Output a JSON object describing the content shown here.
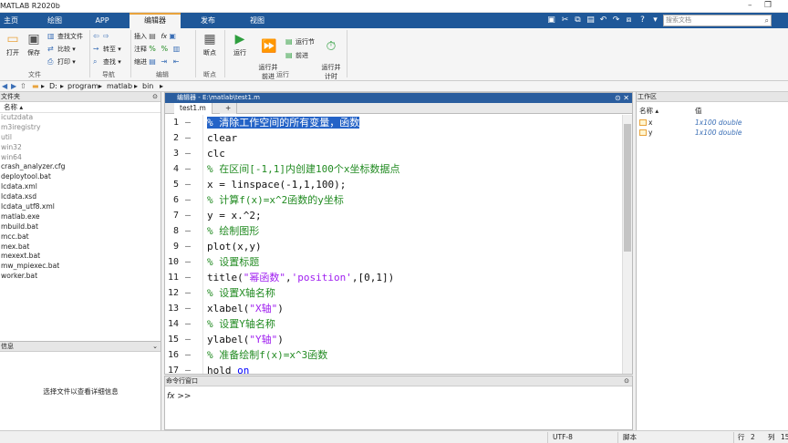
{
  "window": {
    "title": "MATLAB R2020b"
  },
  "tabs": [
    "主页",
    "绘图",
    "APP",
    "编辑器",
    "发布",
    "视图"
  ],
  "search": {
    "placeholder": "搜索文档"
  },
  "ribbon": {
    "file": {
      "open": "打开",
      "save": "保存",
      "find_files": "查找文件",
      "compare": "比较",
      "print": "打印",
      "group": "文件"
    },
    "nav": {
      "goto": "转至",
      "find": "查找",
      "group": "导航"
    },
    "edit": {
      "insert": "插入",
      "comment": "注释",
      "indent": "缩进",
      "fx": "fx",
      "group": "编辑"
    },
    "breakpoints": {
      "label": "断点",
      "group": "断点"
    },
    "run": {
      "run": "运行",
      "run_advance": "运行并\n前进",
      "run_section": "运行节",
      "advance": "前进",
      "run_time": "运行并\n计时",
      "group": "运行"
    }
  },
  "address": {
    "path": [
      "D:",
      "program",
      "matlab",
      "bin"
    ]
  },
  "current_folder": {
    "title": "文件夹",
    "col_name": "名称",
    "files": [
      {
        "name": "icutzdata",
        "dim": true
      },
      {
        "name": "m3iregistry",
        "dim": true
      },
      {
        "name": "util",
        "dim": true
      },
      {
        "name": "win32",
        "dim": true
      },
      {
        "name": "win64",
        "dim": true
      },
      {
        "name": "crash_analyzer.cfg",
        "dim": false
      },
      {
        "name": "deploytool.bat",
        "dim": false
      },
      {
        "name": "lcdata.xml",
        "dim": false
      },
      {
        "name": "lcdata.xsd",
        "dim": false
      },
      {
        "name": "lcdata_utf8.xml",
        "dim": false
      },
      {
        "name": "matlab.exe",
        "dim": false
      },
      {
        "name": "mbuild.bat",
        "dim": false
      },
      {
        "name": "mcc.bat",
        "dim": false
      },
      {
        "name": "mex.bat",
        "dim": false
      },
      {
        "name": "mexext.bat",
        "dim": false
      },
      {
        "name": "mw_mpiexec.bat",
        "dim": false
      },
      {
        "name": "worker.bat",
        "dim": false
      }
    ]
  },
  "details": {
    "title": "信息",
    "message": "选择文件以查看详细信息"
  },
  "editor": {
    "title": "编辑器 - E:\\matlab\\test1.m",
    "tab": "test1.m",
    "add_tab": "+",
    "lines": [
      {
        "n": "1",
        "parts": [
          {
            "t": "% 清除工作空间的所有变量，函数",
            "c": "cm sel"
          }
        ]
      },
      {
        "n": "2",
        "parts": [
          {
            "t": "clear",
            "c": ""
          }
        ]
      },
      {
        "n": "3",
        "parts": [
          {
            "t": "clc",
            "c": ""
          }
        ]
      },
      {
        "n": "4",
        "parts": [
          {
            "t": "% 在区间[-1,1]内创建100个x坐标数据点",
            "c": "cm"
          }
        ]
      },
      {
        "n": "5",
        "parts": [
          {
            "t": "x = linspace(-1,1,100);",
            "c": ""
          }
        ]
      },
      {
        "n": "6",
        "parts": [
          {
            "t": "% 计算f(x)=x^2函数的y坐标",
            "c": "cm"
          }
        ]
      },
      {
        "n": "7",
        "parts": [
          {
            "t": "y = x.^2;",
            "c": ""
          }
        ]
      },
      {
        "n": "8",
        "parts": [
          {
            "t": "% 绘制图形",
            "c": "cm"
          }
        ]
      },
      {
        "n": "9",
        "parts": [
          {
            "t": "plot(x,y)",
            "c": ""
          }
        ]
      },
      {
        "n": "10",
        "parts": [
          {
            "t": "% 设置标题",
            "c": "cm"
          }
        ]
      },
      {
        "n": "11",
        "parts": [
          {
            "t": "title(",
            "c": ""
          },
          {
            "t": "\"幂函数\"",
            "c": "str"
          },
          {
            "t": ",",
            "c": ""
          },
          {
            "t": "'position'",
            "c": "str"
          },
          {
            "t": ",[0,1])",
            "c": ""
          }
        ]
      },
      {
        "n": "12",
        "parts": [
          {
            "t": "% 设置X轴名称",
            "c": "cm"
          }
        ]
      },
      {
        "n": "13",
        "parts": [
          {
            "t": "xlabel(",
            "c": ""
          },
          {
            "t": "\"X轴\"",
            "c": "str"
          },
          {
            "t": ")",
            "c": ""
          }
        ]
      },
      {
        "n": "14",
        "parts": [
          {
            "t": "% 设置Y轴名称",
            "c": "cm"
          }
        ]
      },
      {
        "n": "15",
        "parts": [
          {
            "t": "ylabel(",
            "c": ""
          },
          {
            "t": "\"Y轴\"",
            "c": "str"
          },
          {
            "t": ")",
            "c": ""
          }
        ]
      },
      {
        "n": "16",
        "parts": [
          {
            "t": "% 准备绘制f(x)=x^3函数",
            "c": "cm"
          }
        ]
      },
      {
        "n": "17",
        "parts": [
          {
            "t": "hold ",
            "c": ""
          },
          {
            "t": "on",
            "c": "kw"
          }
        ]
      }
    ]
  },
  "command_window": {
    "title": "命令行窗口",
    "prompt": "fx >>"
  },
  "workspace": {
    "title": "工作区",
    "col_name": "名称",
    "col_value": "值",
    "vars": [
      {
        "name": "x",
        "value": "1x100 double"
      },
      {
        "name": "y",
        "value": "1x100 double"
      }
    ]
  },
  "status": {
    "encoding": "UTF-8",
    "type": "脚本",
    "row_label": "行",
    "row": "2",
    "col_label": "列",
    "col": "15"
  },
  "colors": {
    "tabbar": "#1f5899",
    "accent": "#e8a33d",
    "selection": "#2463c7",
    "comment": "#228b22",
    "string": "#a020f0",
    "keyword": "#0000ff"
  }
}
